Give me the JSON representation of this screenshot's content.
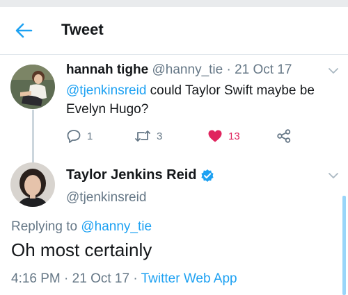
{
  "colors": {
    "accent": "#1da1f2",
    "like": "#e0245e",
    "muted": "#657786",
    "text": "#14171a"
  },
  "appbar": {
    "title": "Tweet",
    "back_icon": "arrow-left-icon"
  },
  "parent_tweet": {
    "name": "hannah tighe",
    "handle": "@hanny_tie",
    "separator": "·",
    "date": "21 Oct 17",
    "mention": "@tjenkinsreid",
    "text_line1": " could Taylor Swift maybe be",
    "text_line2": "Evelyn Hugo?",
    "replies": "1",
    "retweets": "3",
    "likes": "13",
    "liked": true
  },
  "main_tweet": {
    "name": "Taylor Jenkins Reid",
    "verified": true,
    "handle": "@tjenkinsreid",
    "replying_prefix": "Replying to ",
    "replying_to": "@hanny_tie",
    "text": "Oh most certainly",
    "time": "4:16 PM",
    "date": "21 Oct 17",
    "separator": "·",
    "source": "Twitter Web App"
  }
}
